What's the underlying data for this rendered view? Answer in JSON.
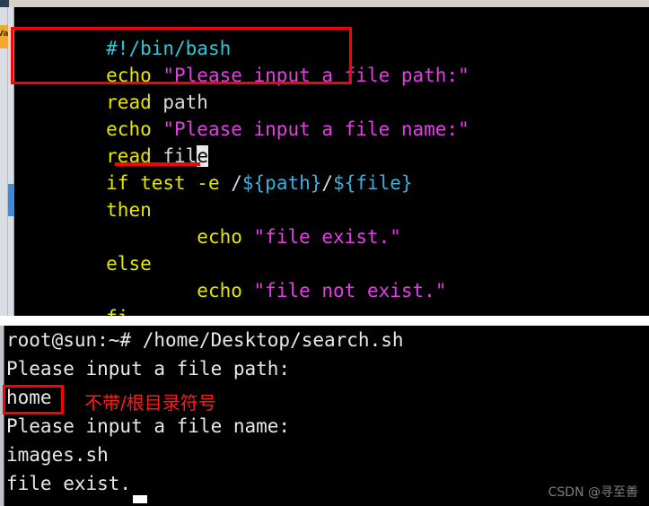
{
  "desktop": {
    "taskbar_item_label": "Va"
  },
  "editor": {
    "scrollbar_name": "editor-vertical-scrollbar",
    "lines": [
      {
        "id": "shebang",
        "segments": [
          {
            "text": "#!/bin/bash",
            "color": "cyan"
          }
        ]
      },
      {
        "id": "echo-path",
        "segments": [
          {
            "text": "echo ",
            "color": "yellow"
          },
          {
            "text": "\"Please input a file path:\"",
            "color": "magenta"
          }
        ]
      },
      {
        "id": "read-path",
        "segments": [
          {
            "text": "read ",
            "color": "yellow"
          },
          {
            "text": "path",
            "color": "white"
          }
        ]
      },
      {
        "id": "echo-name",
        "segments": [
          {
            "text": "echo ",
            "color": "yellow"
          },
          {
            "text": "\"Please input a file name:\"",
            "color": "magenta"
          }
        ]
      },
      {
        "id": "read-file",
        "segments": [
          {
            "text": "read ",
            "color": "yellow"
          },
          {
            "text": "fil",
            "color": "white"
          },
          {
            "text": "e",
            "color": "cursor"
          }
        ]
      },
      {
        "id": "if-test",
        "segments": [
          {
            "text": "if test -e ",
            "color": "yellow"
          },
          {
            "text": "/",
            "color": "white"
          },
          {
            "text": "${path}",
            "color": "lblue"
          },
          {
            "text": "/",
            "color": "white"
          },
          {
            "text": "${file}",
            "color": "lblue"
          }
        ]
      },
      {
        "id": "then",
        "segments": [
          {
            "text": "then",
            "color": "yellow"
          }
        ]
      },
      {
        "id": "echo-exist",
        "segments": [
          {
            "text": "        echo ",
            "color": "yellow"
          },
          {
            "text": "\"file exist.\"",
            "color": "magenta"
          }
        ]
      },
      {
        "id": "else",
        "segments": [
          {
            "text": "else",
            "color": "yellow"
          }
        ]
      },
      {
        "id": "echo-notexist",
        "segments": [
          {
            "text": "        echo ",
            "color": "yellow"
          },
          {
            "text": "\"file not exist.\"",
            "color": "magenta"
          }
        ]
      },
      {
        "id": "fi",
        "segments": [
          {
            "text": "fi",
            "color": "yellow"
          }
        ]
      },
      {
        "id": "tilde",
        "segments": [
          {
            "text": "~",
            "color": "blue"
          }
        ]
      }
    ],
    "text_lines_plain": [
      "#!/bin/bash",
      "echo \"Please input a file path:\"",
      "read path",
      "echo \"Please input a file name:\"",
      "read file",
      "if test -e /${path}/${file}",
      "then",
      "        echo \"file exist.\"",
      "else",
      "        echo \"file not exist.\"",
      "fi",
      "~"
    ]
  },
  "terminal": {
    "lines": [
      "root@sun:~# /home/Desktop/search.sh",
      "Please input a file path:",
      "home",
      "Please input a file name:",
      "images.sh",
      "file exist."
    ],
    "prompt": "root@sun:~#",
    "command": "/home/Desktop/search.sh",
    "input_path": "home",
    "input_name": "images.sh",
    "result": "file exist."
  },
  "annotations": {
    "box_editor_read_path": "highlight around echo/read path lines",
    "underline_path_var": "red underline under /${path}",
    "box_terminal_home": "highlight around home input",
    "note_cn": "不带/根目录符号"
  },
  "colors": {
    "annotation_red": "#ff0000",
    "code_cyan": "#34c6d6",
    "code_yellow": "#e6e600",
    "code_magenta": "#e040e0",
    "code_lightblue": "#3ab0e0",
    "terminal_text": "#e8e8e8",
    "taskbar_orange": "#f0a830",
    "scrollbar_blue": "#3b8ce0"
  },
  "watermark": {
    "text": "CSDN @寻至善"
  }
}
